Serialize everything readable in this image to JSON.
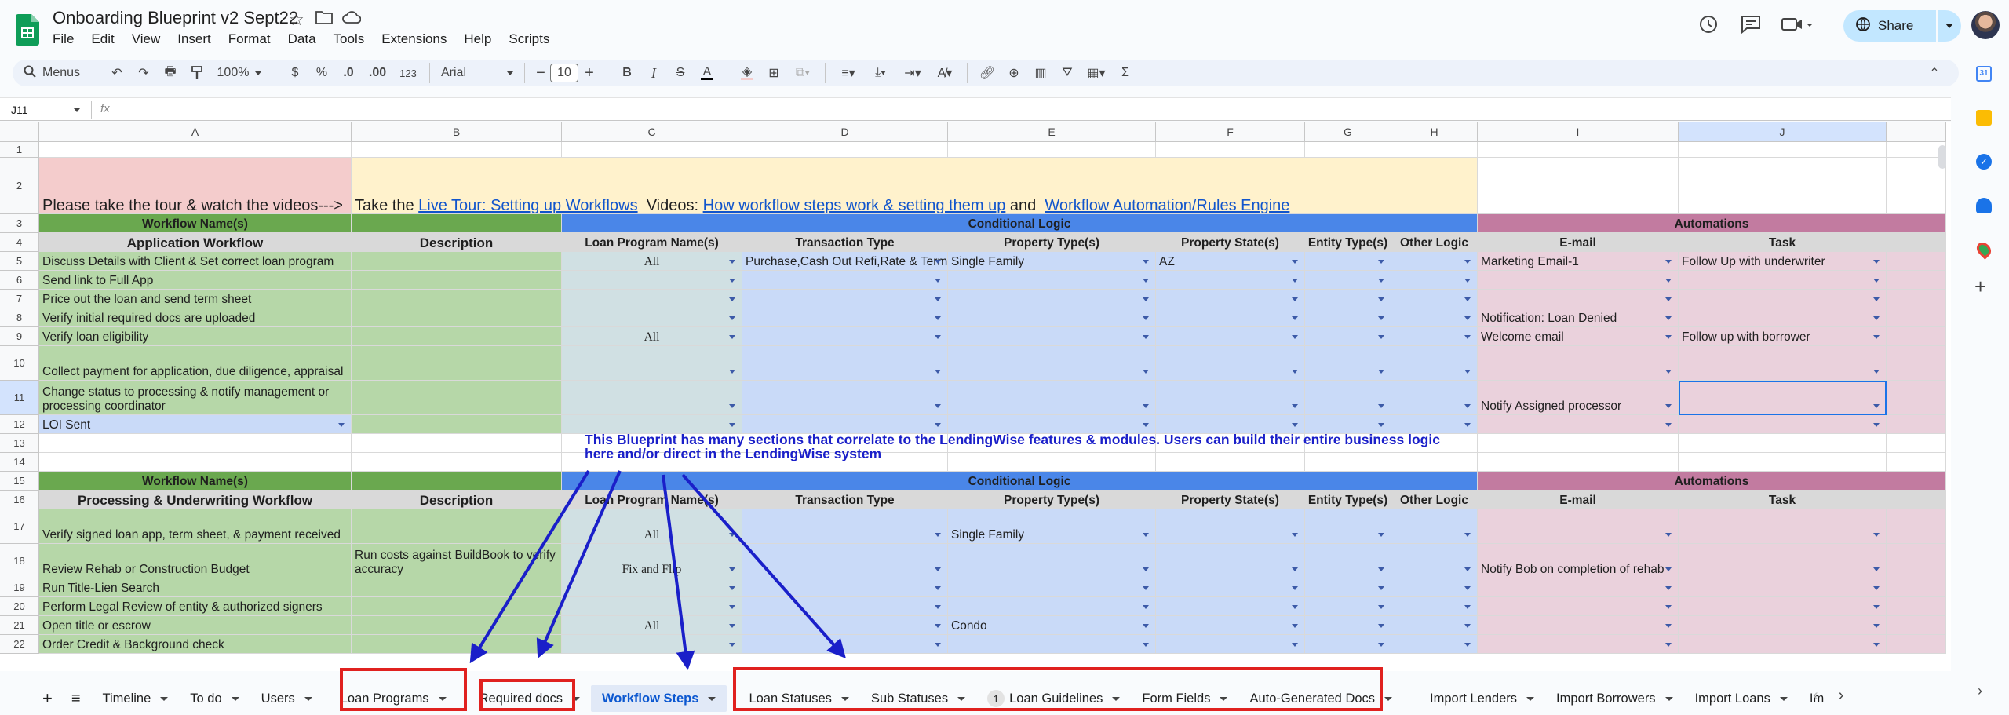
{
  "doc": {
    "title": "Onboarding Blueprint v2 Sept22",
    "menus": [
      "File",
      "Edit",
      "View",
      "Insert",
      "Format",
      "Data",
      "Tools",
      "Extensions",
      "Help",
      "Scripts"
    ]
  },
  "header": {
    "share_label": "Share"
  },
  "toolbar": {
    "menus_label": "Menus",
    "zoom": "100%",
    "currency": "$",
    "percent": "%",
    "dec_less": ".0",
    "dec_more": ".00",
    "num_format": "123",
    "font": "Arial",
    "font_size": "10"
  },
  "formula": {
    "cell_ref": "J11",
    "fx": "fx",
    "value": ""
  },
  "columns": [
    "A",
    "B",
    "C",
    "D",
    "E",
    "F",
    "G",
    "H",
    "I",
    "J"
  ],
  "rows": [
    "1",
    "2",
    "3",
    "4",
    "5",
    "6",
    "7",
    "8",
    "9",
    "10",
    "11",
    "12",
    "13",
    "14",
    "15",
    "16",
    "17",
    "18",
    "19",
    "20",
    "21",
    "22"
  ],
  "sheet": {
    "tour_prompt": "Please take the tour & watch the videos--->",
    "take_the": "Take the",
    "tour_link": "Live Tour: Setting up Workflows",
    "videos_label": "Videos:",
    "video_link1": "How workflow steps work & setting them up",
    "and_label": "and",
    "video_link2": "Workflow Automation/Rules Engine",
    "h_workflow_names": "Workflow Name(s)",
    "h_conditional": "Conditional Logic",
    "h_automations": "Automations",
    "h_app_workflow": "Application Workflow",
    "h_proc_workflow": "Processing & Underwriting Workflow",
    "h_description": "Description",
    "h_loan_program": "Loan Program Name(s)",
    "h_transaction": "Transaction Type",
    "h_property_type": "Property Type(s)",
    "h_property_state": "Property State(s)",
    "h_entity": "Entity Type(s)",
    "h_other": "Other Logic",
    "h_email": "E-mail",
    "h_task": "Task",
    "app_rows": [
      {
        "name": "Discuss Details with Client & Set correct loan program",
        "program": "All",
        "transaction": "Purchase,Cash Out Refi,Rate & Term",
        "property": "Single Family",
        "state": "AZ",
        "email": "Marketing Email-1",
        "task": "Follow Up with underwriter"
      },
      {
        "name": "Send link to Full App",
        "program": "",
        "transaction": "",
        "property": "",
        "state": "",
        "email": "",
        "task": ""
      },
      {
        "name": "Price out the loan and send term sheet",
        "program": "",
        "transaction": "",
        "property": "",
        "state": "",
        "email": "",
        "task": ""
      },
      {
        "name": "Verify initial required docs are uploaded",
        "program": "",
        "transaction": "",
        "property": "",
        "state": "",
        "email": "Notification: Loan Denied",
        "task": ""
      },
      {
        "name": "Verify loan eligibility",
        "program": "All",
        "transaction": "",
        "property": "",
        "state": "",
        "email": "Welcome email",
        "task": "Follow up with borrower"
      },
      {
        "name": "Collect payment for application, due diligence, appraisal",
        "program": "",
        "transaction": "",
        "property": "",
        "state": "",
        "email": "",
        "task": ""
      },
      {
        "name": "Change status to processing & notify management or processing coordinator",
        "program": "",
        "transaction": "",
        "property": "",
        "state": "",
        "email": "Notify Assigned processor",
        "task": ""
      },
      {
        "name": "LOI Sent",
        "program": "",
        "transaction": "",
        "property": "",
        "state": "",
        "email": "",
        "task": ""
      }
    ],
    "blueprint_note": "This Blueprint has many sections that correlate to the LendingWise features & modules. Users can build their entire business logic here and/or direct in the LendingWise system",
    "proc_rows": [
      {
        "name": "Verify signed loan app, term sheet, & payment received",
        "desc": "",
        "program": "All",
        "property": "Single Family",
        "email": ""
      },
      {
        "name": "Review Rehab or Construction Budget",
        "desc": "Run costs against BuildBook to verify accuracy",
        "program": "Fix and Flip",
        "property": "",
        "email": "Notify Bob on completion of rehab"
      },
      {
        "name": "Run Title-Lien Search",
        "desc": "",
        "program": "",
        "property": "",
        "email": ""
      },
      {
        "name": "Perform Legal Review of entity & authorized signers",
        "desc": "",
        "program": "",
        "property": "",
        "email": ""
      },
      {
        "name": "Open title or escrow",
        "desc": "",
        "program": "All",
        "property": "Condo",
        "email": ""
      },
      {
        "name": "Order Credit & Background check",
        "desc": "",
        "program": "",
        "property": "",
        "email": ""
      }
    ]
  },
  "tabs": [
    {
      "label": "Timeline"
    },
    {
      "label": "To do"
    },
    {
      "label": "Users"
    },
    {
      "label": "Loan Programs"
    },
    {
      "label": "Required docs"
    },
    {
      "label": "Workflow Steps"
    },
    {
      "label": "Loan Statuses"
    },
    {
      "label": "Sub Statuses"
    },
    {
      "label": "Loan Guidelines",
      "badge": "1"
    },
    {
      "label": "Form Fields"
    },
    {
      "label": "Auto-Generated Docs"
    },
    {
      "label": "Import Lenders"
    },
    {
      "label": "Import Borrowers"
    },
    {
      "label": "Import Loans"
    },
    {
      "label": "Im"
    }
  ],
  "colors": {
    "red_box": "#e0211f",
    "arrow": "#1a1fc9",
    "active_tab": "#0b57d0"
  }
}
